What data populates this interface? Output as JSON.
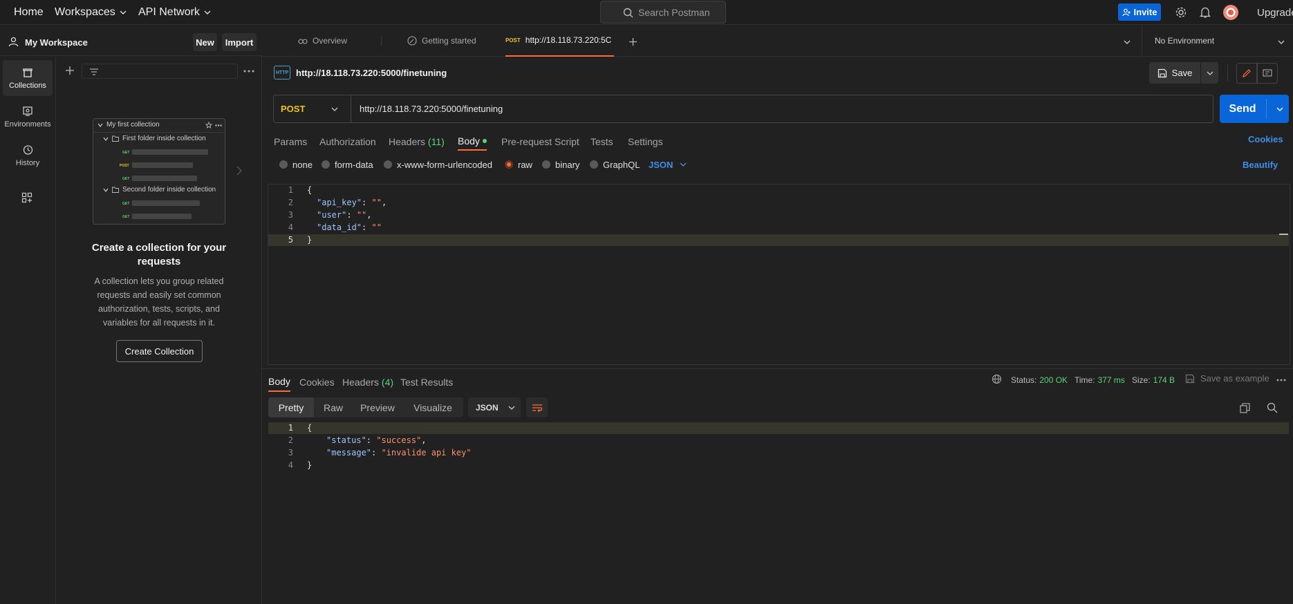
{
  "topbar": {
    "home": "Home",
    "workspaces": "Workspaces",
    "api_network": "API Network",
    "search_placeholder": "Search Postman",
    "invite": "Invite",
    "upgrade": "Upgrade"
  },
  "sidebar": {
    "workspace_name": "My Workspace",
    "new_label": "New",
    "import_label": "Import",
    "rail": [
      {
        "label": "Collections",
        "icon": "collections-icon",
        "active": true
      },
      {
        "label": "Environments",
        "icon": "environments-icon",
        "active": false
      },
      {
        "label": "History",
        "icon": "history-icon",
        "active": false
      }
    ],
    "illustration": {
      "collection_title": "My first collection",
      "folder1": "First folder inside collection",
      "folder2": "Second folder inside collection",
      "methods": [
        "GET",
        "POST",
        "GET",
        "GET",
        "GET"
      ]
    },
    "empty_title": "Create a collection for your requests",
    "empty_desc": "A collection lets you group related requests and easily set common authorization, tests, scripts, and variables for all requests in it.",
    "create_btn": "Create Collection"
  },
  "tabs": {
    "overview": "Overview",
    "getting_started": "Getting started",
    "active_method": "POST",
    "active_url": "http://18.118.73.220:5C",
    "environment": "No Environment"
  },
  "request": {
    "title": "http://18.118.73.220:5000/finetuning",
    "save": "Save",
    "method": "POST",
    "url": "http://18.118.73.220:5000/finetuning",
    "send": "Send",
    "subtabs": {
      "params": "Params",
      "authorization": "Authorization",
      "headers": "Headers",
      "headers_count": "(11)",
      "body": "Body",
      "prerequest": "Pre-request Script",
      "tests": "Tests",
      "settings": "Settings"
    },
    "cookies": "Cookies",
    "body_modes": [
      "none",
      "form-data",
      "x-www-form-urlencoded",
      "raw",
      "binary",
      "GraphQL"
    ],
    "selected_mode": "raw",
    "body_type": "JSON",
    "beautify": "Beautify",
    "body_lines": [
      "1",
      "2",
      "3",
      "4",
      "5"
    ],
    "body_keys": [
      "\"api_key\"",
      "\"user\"",
      "\"data_id\""
    ],
    "body_values": [
      "\"\"",
      "\"\"",
      "\"\""
    ]
  },
  "response": {
    "tabs": {
      "body": "Body",
      "cookies": "Cookies",
      "headers": "Headers",
      "headers_count": "(4)",
      "test_results": "Test Results"
    },
    "status_label": "Status:",
    "status_value": "200 OK",
    "time_label": "Time:",
    "time_value": "377 ms",
    "size_label": "Size:",
    "size_value": "174 B",
    "save_example": "Save as example",
    "views": [
      "Pretty",
      "Raw",
      "Preview",
      "Visualize"
    ],
    "format": "JSON",
    "lines": [
      "1",
      "2",
      "3",
      "4"
    ],
    "status_key": "\"status\"",
    "status_val": "\"success\"",
    "message_key": "\"message\"",
    "message_val": "\"invalide api key\""
  },
  "colors": {
    "accent": "#ff6c37",
    "primary": "#0a66d8",
    "success": "#5dd37a",
    "json_key": "#9cc4ff",
    "json_string": "#ff8f6b"
  }
}
